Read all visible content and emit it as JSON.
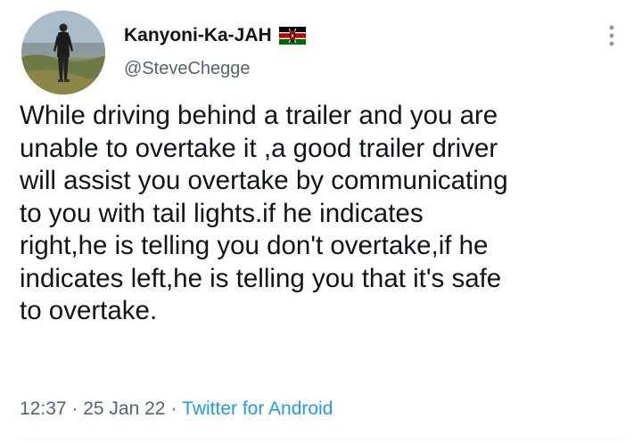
{
  "tweet": {
    "author": {
      "display_name": "Kanyoni-Ka-JAH",
      "handle": "@SteveChegge",
      "flag_icon": "kenya-flag-icon",
      "avatar_icon": "avatar"
    },
    "text": "While driving behind a trailer and you are\nunable to overtake it ,a good trailer driver\nwill assist you overtake by communicating\nto you with tail lights.if he indicates\nright,he is telling you don't overtake,if he\nindicates left,he is telling you that it's safe\nto overtake.",
    "time": "12:37",
    "separator": " · ",
    "date": "25 Jan 22",
    "source": "Twitter for Android",
    "more_icon": "more-options-icon"
  },
  "colors": {
    "text": "#0f1419",
    "secondary": "#536471",
    "link": "#1d9bf0",
    "divider": "#eff3f4"
  }
}
